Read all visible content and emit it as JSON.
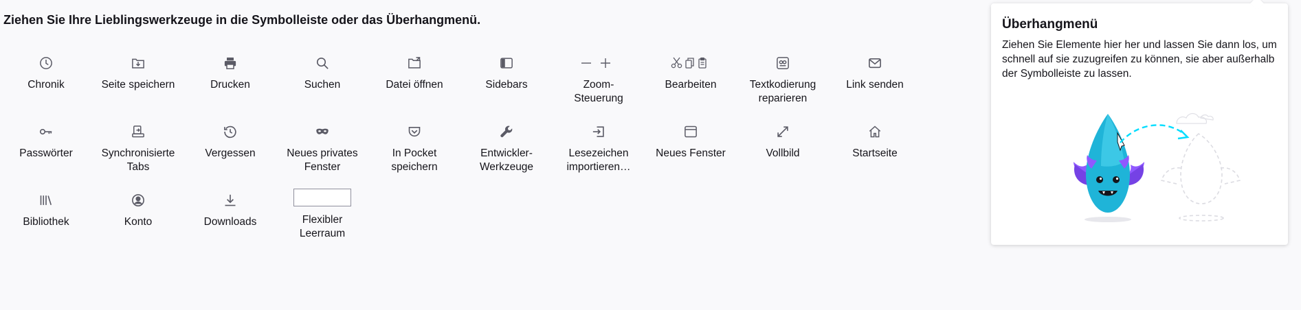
{
  "heading": "Ziehen Sie Ihre Lieblingswerkzeuge in die Symbolleiste oder das Überhangmenü.",
  "palette_items": [
    {
      "label": "Chronik",
      "icon": "clock-icon"
    },
    {
      "label": "Seite speichern",
      "icon": "save-page-icon"
    },
    {
      "label": "Drucken",
      "icon": "printer-icon"
    },
    {
      "label": "Suchen",
      "icon": "search-icon"
    },
    {
      "label": "Datei öffnen",
      "icon": "open-file-icon"
    },
    {
      "label": "Sidebars",
      "icon": "sidebar-icon"
    },
    {
      "label": "Zoom-\nSteuerung",
      "icon": "zoom-controls-icon"
    },
    {
      "label": "Bearbeiten",
      "icon": "edit-controls-icon"
    },
    {
      "label": "Textkodierung\nreparieren",
      "icon": "text-encoding-icon"
    },
    {
      "label": "Link senden",
      "icon": "mail-icon"
    },
    {
      "label": "Passwörter",
      "icon": "key-icon"
    },
    {
      "label": "Synchronisierte\nTabs",
      "icon": "synced-tabs-icon"
    },
    {
      "label": "Vergessen",
      "icon": "forget-icon"
    },
    {
      "label": "Neues privates\nFenster",
      "icon": "private-mask-icon"
    },
    {
      "label": "In Pocket\nspeichern",
      "icon": "pocket-icon"
    },
    {
      "label": "Entwickler-\nWerkzeuge",
      "icon": "wrench-icon"
    },
    {
      "label": "Lesezeichen\nimportieren…",
      "icon": "import-icon"
    },
    {
      "label": "Neues Fenster",
      "icon": "new-window-icon"
    },
    {
      "label": "Vollbild",
      "icon": "fullscreen-icon"
    },
    {
      "label": "Startseite",
      "icon": "home-icon"
    },
    {
      "label": "Bibliothek",
      "icon": "library-icon"
    },
    {
      "label": "Konto",
      "icon": "account-icon"
    },
    {
      "label": "Downloads",
      "icon": "download-icon"
    }
  ],
  "flexible_space": {
    "label": "Flexibler\nLeerraum"
  },
  "overflow_panel": {
    "title": "Überhangmenü",
    "description": "Ziehen Sie Elemente hier her und lassen Sie dann los, um schnell auf sie zuzugreifen zu können, sie aber außerhalb der Symbolleiste zu lassen."
  },
  "colors": {
    "background": "#f9f9fb",
    "text": "#15141a",
    "icon": "#5b5b66",
    "illustration_blue": "#1fb4d8",
    "illustration_purple": "#9059ff",
    "illustration_cyan": "#00ddff"
  }
}
